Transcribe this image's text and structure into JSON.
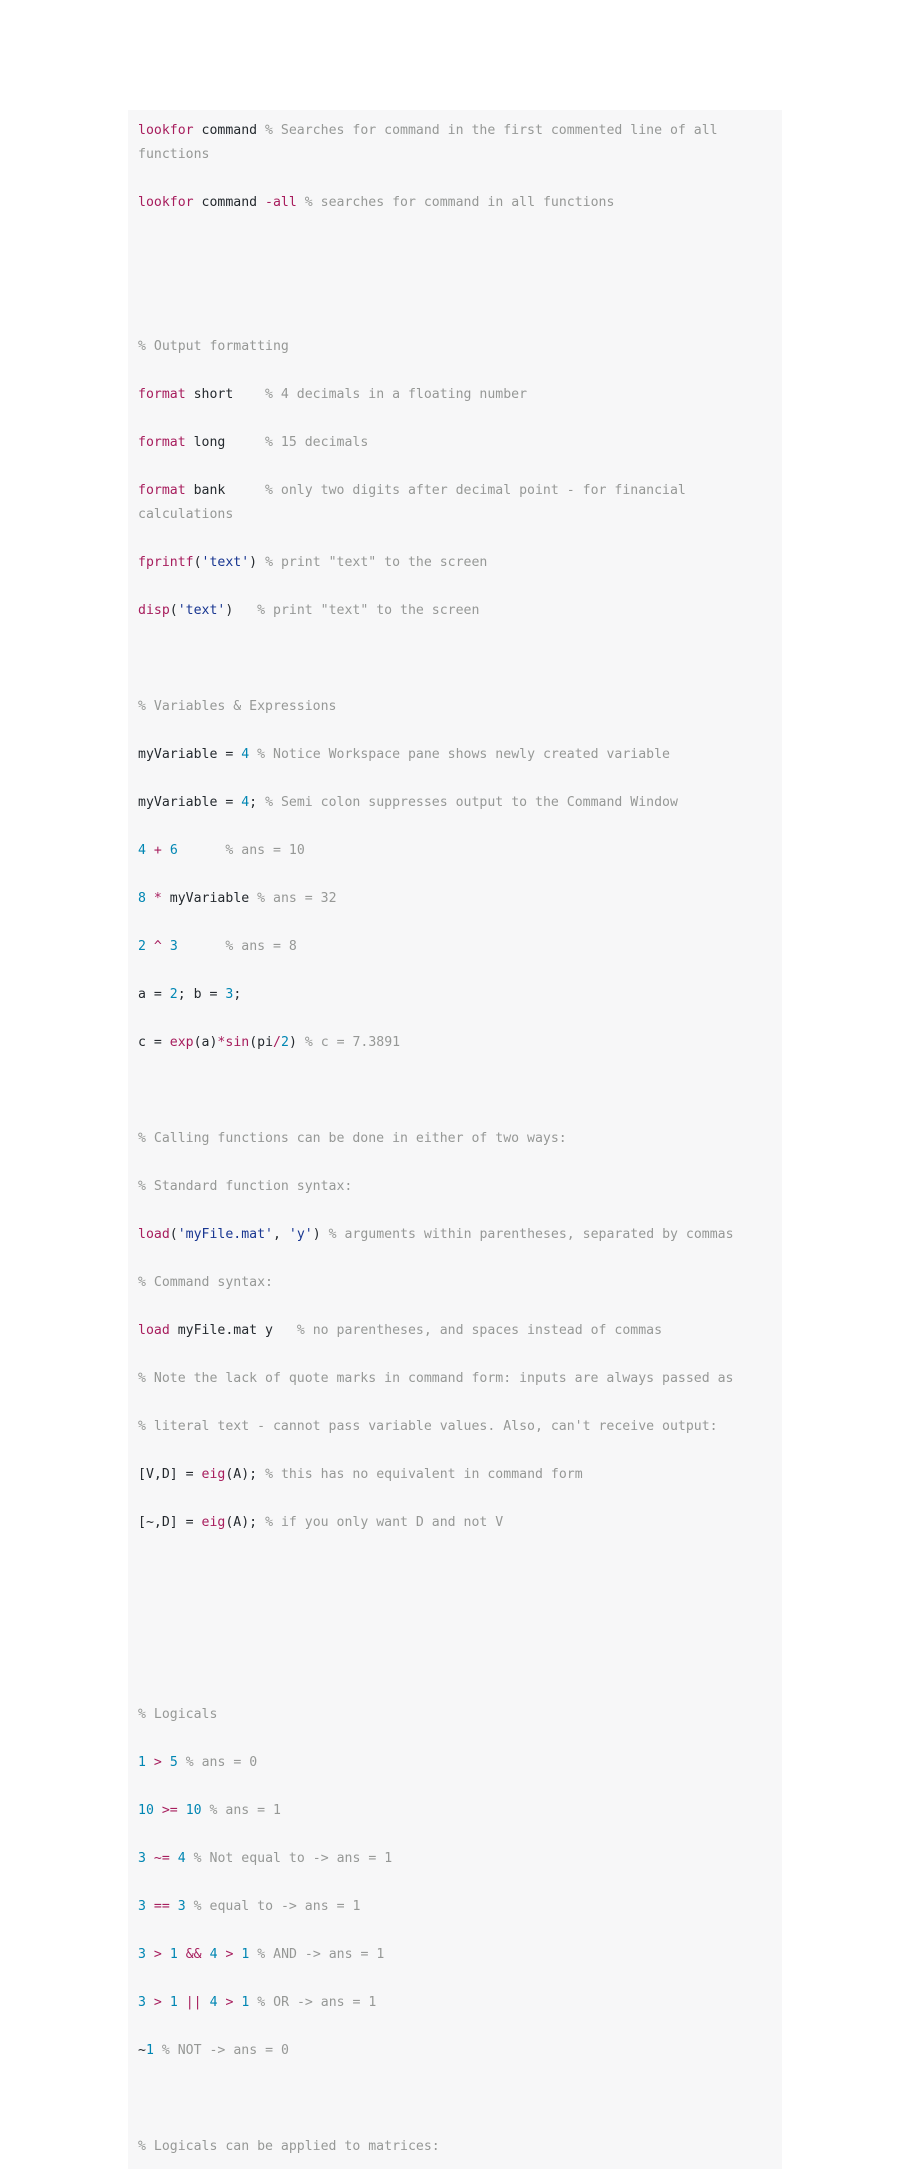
{
  "page": {
    "kind": "code-listing",
    "language": "matlab",
    "background": "#ffffff",
    "panel_background": "#f7f7f8"
  },
  "colors": {
    "keyword": "#a71d5d",
    "operator": "#a71d5d",
    "string": "#183691",
    "number": "#0086b3",
    "comment": "#969896",
    "text": "#24292e",
    "panel": "#f7f7f8",
    "page": "#ffffff"
  },
  "code": {
    "lines": [
      [
        {
          "t": "kw",
          "v": "lookfor"
        },
        {
          "t": "txt",
          "v": " command "
        },
        {
          "t": "com",
          "v": "% Searches for command in the first commented line of all functions"
        }
      ],
      [
        {
          "t": "kw",
          "v": "lookfor"
        },
        {
          "t": "txt",
          "v": " command "
        },
        {
          "t": "kw",
          "v": "-all"
        },
        {
          "t": "txt",
          "v": " "
        },
        {
          "t": "com",
          "v": "% searches for command in all functions"
        }
      ],
      [],
      [],
      [
        {
          "t": "com",
          "v": "% Output formatting"
        }
      ],
      [
        {
          "t": "kw",
          "v": "format"
        },
        {
          "t": "txt",
          "v": " short    "
        },
        {
          "t": "com",
          "v": "% 4 decimals in a floating number"
        }
      ],
      [
        {
          "t": "kw",
          "v": "format"
        },
        {
          "t": "txt",
          "v": " long     "
        },
        {
          "t": "com",
          "v": "% 15 decimals"
        }
      ],
      [
        {
          "t": "kw",
          "v": "format"
        },
        {
          "t": "txt",
          "v": " bank     "
        },
        {
          "t": "com",
          "v": "% only two digits after decimal point - for financial calculations"
        }
      ],
      [
        {
          "t": "kw",
          "v": "fprintf"
        },
        {
          "t": "txt",
          "v": "("
        },
        {
          "t": "str",
          "v": "'text'"
        },
        {
          "t": "txt",
          "v": ") "
        },
        {
          "t": "com",
          "v": "% print \"text\" to the screen"
        }
      ],
      [
        {
          "t": "kw",
          "v": "disp"
        },
        {
          "t": "txt",
          "v": "("
        },
        {
          "t": "str",
          "v": "'text'"
        },
        {
          "t": "txt",
          "v": ")   "
        },
        {
          "t": "com",
          "v": "% print \"text\" to the screen"
        }
      ],
      [],
      [
        {
          "t": "com",
          "v": "% Variables & Expressions"
        }
      ],
      [
        {
          "t": "txt",
          "v": "myVariable = "
        },
        {
          "t": "num",
          "v": "4"
        },
        {
          "t": "txt",
          "v": " "
        },
        {
          "t": "com",
          "v": "% Notice Workspace pane shows newly created variable"
        }
      ],
      [
        {
          "t": "txt",
          "v": "myVariable = "
        },
        {
          "t": "num",
          "v": "4"
        },
        {
          "t": "txt",
          "v": "; "
        },
        {
          "t": "com",
          "v": "% Semi colon suppresses output to the Command Window"
        }
      ],
      [
        {
          "t": "num",
          "v": "4"
        },
        {
          "t": "txt",
          "v": " "
        },
        {
          "t": "op",
          "v": "+"
        },
        {
          "t": "txt",
          "v": " "
        },
        {
          "t": "num",
          "v": "6"
        },
        {
          "t": "txt",
          "v": "      "
        },
        {
          "t": "com",
          "v": "% ans = 10"
        }
      ],
      [
        {
          "t": "num",
          "v": "8"
        },
        {
          "t": "txt",
          "v": " "
        },
        {
          "t": "op",
          "v": "*"
        },
        {
          "t": "txt",
          "v": " myVariable "
        },
        {
          "t": "com",
          "v": "% ans = 32"
        }
      ],
      [
        {
          "t": "num",
          "v": "2"
        },
        {
          "t": "txt",
          "v": " "
        },
        {
          "t": "op",
          "v": "^"
        },
        {
          "t": "txt",
          "v": " "
        },
        {
          "t": "num",
          "v": "3"
        },
        {
          "t": "txt",
          "v": "      "
        },
        {
          "t": "com",
          "v": "% ans = 8"
        }
      ],
      [
        {
          "t": "txt",
          "v": "a = "
        },
        {
          "t": "num",
          "v": "2"
        },
        {
          "t": "txt",
          "v": "; b = "
        },
        {
          "t": "num",
          "v": "3"
        },
        {
          "t": "txt",
          "v": ";"
        }
      ],
      [
        {
          "t": "txt",
          "v": "c = "
        },
        {
          "t": "kw",
          "v": "exp"
        },
        {
          "t": "txt",
          "v": "(a)"
        },
        {
          "t": "op",
          "v": "*"
        },
        {
          "t": "kw",
          "v": "sin"
        },
        {
          "t": "txt",
          "v": "(pi"
        },
        {
          "t": "op",
          "v": "/"
        },
        {
          "t": "num",
          "v": "2"
        },
        {
          "t": "txt",
          "v": ") "
        },
        {
          "t": "com",
          "v": "% c = 7.3891"
        }
      ],
      [],
      [
        {
          "t": "com",
          "v": "% Calling functions can be done in either of two ways:"
        }
      ],
      [
        {
          "t": "com",
          "v": "% Standard function syntax:"
        }
      ],
      [
        {
          "t": "kw",
          "v": "load"
        },
        {
          "t": "txt",
          "v": "("
        },
        {
          "t": "str",
          "v": "'myFile.mat'"
        },
        {
          "t": "txt",
          "v": ", "
        },
        {
          "t": "str",
          "v": "'y'"
        },
        {
          "t": "txt",
          "v": ") "
        },
        {
          "t": "com",
          "v": "% arguments within parentheses, separated by commas"
        }
      ],
      [
        {
          "t": "com",
          "v": "% Command syntax:"
        }
      ],
      [
        {
          "t": "kw",
          "v": "load"
        },
        {
          "t": "txt",
          "v": " myFile.mat y   "
        },
        {
          "t": "com",
          "v": "% no parentheses, and spaces instead of commas"
        }
      ],
      [
        {
          "t": "com",
          "v": "% Note the lack of quote marks in command form: inputs are always passed as"
        }
      ],
      [
        {
          "t": "com",
          "v": "% literal text - cannot pass variable values. Also, can't receive output:"
        }
      ],
      [
        {
          "t": "txt",
          "v": "[V,D] = "
        },
        {
          "t": "kw",
          "v": "eig"
        },
        {
          "t": "txt",
          "v": "(A); "
        },
        {
          "t": "com",
          "v": "% this has no equivalent in command form"
        }
      ],
      [
        {
          "t": "txt",
          "v": "[~,D] = "
        },
        {
          "t": "kw",
          "v": "eig"
        },
        {
          "t": "txt",
          "v": "(A); "
        },
        {
          "t": "com",
          "v": "% if you only want D and not V"
        }
      ],
      [],
      [],
      [],
      [
        {
          "t": "com",
          "v": "% Logicals"
        }
      ],
      [
        {
          "t": "num",
          "v": "1"
        },
        {
          "t": "txt",
          "v": " "
        },
        {
          "t": "op",
          "v": ">"
        },
        {
          "t": "txt",
          "v": " "
        },
        {
          "t": "num",
          "v": "5"
        },
        {
          "t": "txt",
          "v": " "
        },
        {
          "t": "com",
          "v": "% ans = 0"
        }
      ],
      [
        {
          "t": "num",
          "v": "10"
        },
        {
          "t": "txt",
          "v": " "
        },
        {
          "t": "op",
          "v": ">="
        },
        {
          "t": "txt",
          "v": " "
        },
        {
          "t": "num",
          "v": "10"
        },
        {
          "t": "txt",
          "v": " "
        },
        {
          "t": "com",
          "v": "% ans = 1"
        }
      ],
      [
        {
          "t": "num",
          "v": "3"
        },
        {
          "t": "txt",
          "v": " "
        },
        {
          "t": "op",
          "v": "~="
        },
        {
          "t": "txt",
          "v": " "
        },
        {
          "t": "num",
          "v": "4"
        },
        {
          "t": "txt",
          "v": " "
        },
        {
          "t": "com",
          "v": "% Not equal to -> ans = 1"
        }
      ],
      [
        {
          "t": "num",
          "v": "3"
        },
        {
          "t": "txt",
          "v": " "
        },
        {
          "t": "op",
          "v": "=="
        },
        {
          "t": "txt",
          "v": " "
        },
        {
          "t": "num",
          "v": "3"
        },
        {
          "t": "txt",
          "v": " "
        },
        {
          "t": "com",
          "v": "% equal to -> ans = 1"
        }
      ],
      [
        {
          "t": "num",
          "v": "3"
        },
        {
          "t": "txt",
          "v": " "
        },
        {
          "t": "op",
          "v": ">"
        },
        {
          "t": "txt",
          "v": " "
        },
        {
          "t": "num",
          "v": "1"
        },
        {
          "t": "txt",
          "v": " "
        },
        {
          "t": "op",
          "v": "&&"
        },
        {
          "t": "txt",
          "v": " "
        },
        {
          "t": "num",
          "v": "4"
        },
        {
          "t": "txt",
          "v": " "
        },
        {
          "t": "op",
          "v": ">"
        },
        {
          "t": "txt",
          "v": " "
        },
        {
          "t": "num",
          "v": "1"
        },
        {
          "t": "txt",
          "v": " "
        },
        {
          "t": "com",
          "v": "% AND -> ans = 1"
        }
      ],
      [
        {
          "t": "num",
          "v": "3"
        },
        {
          "t": "txt",
          "v": " "
        },
        {
          "t": "op",
          "v": ">"
        },
        {
          "t": "txt",
          "v": " "
        },
        {
          "t": "num",
          "v": "1"
        },
        {
          "t": "txt",
          "v": " "
        },
        {
          "t": "op",
          "v": "||"
        },
        {
          "t": "txt",
          "v": " "
        },
        {
          "t": "num",
          "v": "4"
        },
        {
          "t": "txt",
          "v": " "
        },
        {
          "t": "op",
          "v": ">"
        },
        {
          "t": "txt",
          "v": " "
        },
        {
          "t": "num",
          "v": "1"
        },
        {
          "t": "txt",
          "v": " "
        },
        {
          "t": "com",
          "v": "% OR -> ans = 1"
        }
      ],
      [
        {
          "t": "txt",
          "v": "~"
        },
        {
          "t": "num",
          "v": "1"
        },
        {
          "t": "txt",
          "v": " "
        },
        {
          "t": "com",
          "v": "% NOT -> ans = 0"
        }
      ],
      [],
      [
        {
          "t": "com",
          "v": "% Logicals can be applied to matrices:"
        }
      ]
    ]
  }
}
